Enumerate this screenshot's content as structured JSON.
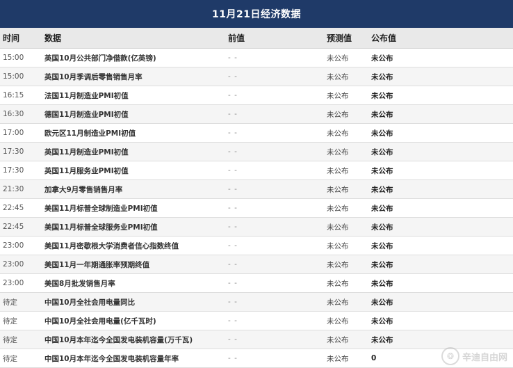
{
  "title": "11月21日经济数据",
  "headers": {
    "time": "时间",
    "name": "数据",
    "prev": "前值",
    "forecast": "预测值",
    "published": "公布值"
  },
  "rows": [
    {
      "time": "15:00",
      "name": "英国10月公共部门净借款(亿英镑)",
      "prev": "- -",
      "forecast": "未公布",
      "published": "未公布"
    },
    {
      "time": "15:00",
      "name": "英国10月季调后零售销售月率",
      "prev": "- -",
      "forecast": "未公布",
      "published": "未公布"
    },
    {
      "time": "16:15",
      "name": "法国11月制造业PMI初值",
      "prev": "- -",
      "forecast": "未公布",
      "published": "未公布"
    },
    {
      "time": "16:30",
      "name": "德国11月制造业PMI初值",
      "prev": "- -",
      "forecast": "未公布",
      "published": "未公布"
    },
    {
      "time": "17:00",
      "name": "欧元区11月制造业PMI初值",
      "prev": "- -",
      "forecast": "未公布",
      "published": "未公布"
    },
    {
      "time": "17:30",
      "name": "英国11月制造业PMI初值",
      "prev": "- -",
      "forecast": "未公布",
      "published": "未公布"
    },
    {
      "time": "17:30",
      "name": "英国11月服务业PMI初值",
      "prev": "- -",
      "forecast": "未公布",
      "published": "未公布"
    },
    {
      "time": "21:30",
      "name": "加拿大9月零售销售月率",
      "prev": "- -",
      "forecast": "未公布",
      "published": "未公布"
    },
    {
      "time": "22:45",
      "name": "美国11月标普全球制造业PMI初值",
      "prev": "- -",
      "forecast": "未公布",
      "published": "未公布"
    },
    {
      "time": "22:45",
      "name": "美国11月标普全球服务业PMI初值",
      "prev": "- -",
      "forecast": "未公布",
      "published": "未公布"
    },
    {
      "time": "23:00",
      "name": "美国11月密歇根大学消费者信心指数终值",
      "prev": "- -",
      "forecast": "未公布",
      "published": "未公布"
    },
    {
      "time": "23:00",
      "name": "美国11月一年期通胀率预期终值",
      "prev": "- -",
      "forecast": "未公布",
      "published": "未公布"
    },
    {
      "time": "23:00",
      "name": "美国8月批发销售月率",
      "prev": "- -",
      "forecast": "未公布",
      "published": "未公布"
    },
    {
      "time": "待定",
      "name": "中国10月全社会用电量同比",
      "prev": "- -",
      "forecast": "未公布",
      "published": "未公布"
    },
    {
      "time": "待定",
      "name": "中国10月全社会用电量(亿千瓦时)",
      "prev": "- -",
      "forecast": "未公布",
      "published": "未公布"
    },
    {
      "time": "待定",
      "name": "中国10月本年迄今全国发电装机容量(万千瓦)",
      "prev": "- -",
      "forecast": "未公布",
      "published": "未公布"
    },
    {
      "time": "待定",
      "name": "中国10月本年迄今全国发电装机容量年率",
      "prev": "- -",
      "forecast": "未公布",
      "published": "0"
    }
  ],
  "colors": {
    "title_bg": "#1f3a68",
    "title_text": "#ffffff",
    "header_bg": "#e9e9e9"
  },
  "watermark": {
    "icon": "watermark-logo-icon",
    "text": "辛迪自由网"
  }
}
